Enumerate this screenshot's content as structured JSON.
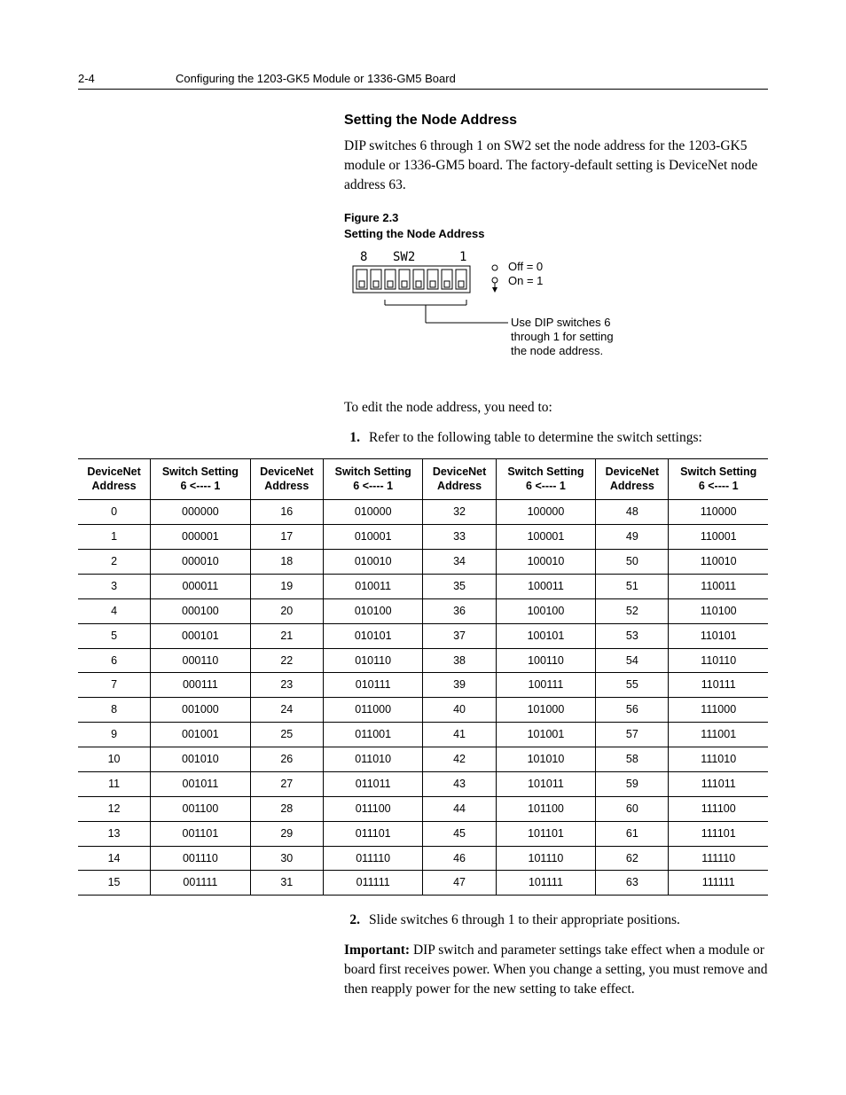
{
  "pageNumber": "2-4",
  "runningHeader": "Configuring the 1203-GK5 Module or 1336-GM5 Board",
  "sectionTitle": "Setting the Node Address",
  "intro": "DIP switches 6 through 1 on SW2 set the node address for the 1203-GK5 module or 1336-GM5 board. The factory-default setting is DeviceNet node address 63.",
  "figureNumber": "Figure 2.3",
  "figureTitle": "Setting the Node Address",
  "fig": {
    "swLeft": "8",
    "swLabel": "SW2",
    "swRight": "1",
    "off": "Off = 0",
    "on": "On = 1",
    "callout1": "Use DIP switches 6",
    "callout2": "through 1 for setting",
    "callout3": "the node address."
  },
  "leadIn": "To edit the node address, you need to:",
  "step1": "Refer to the following table to determine the switch settings:",
  "step2": "Slide switches 6 through 1 to their appropriate positions.",
  "importantLabel": "Important:",
  "importantText": " DIP switch and parameter settings take effect when a module or board first receives power. When you change a setting, you must remove and then reapply power for the new setting to take effect.",
  "table": {
    "hAddr": "DeviceNet Address",
    "hSwitch": "Switch Setting 6 <---- 1",
    "rows": [
      {
        "a0": "0",
        "s0": "000000",
        "a1": "16",
        "s1": "010000",
        "a2": "32",
        "s2": "100000",
        "a3": "48",
        "s3": "110000"
      },
      {
        "a0": "1",
        "s0": "000001",
        "a1": "17",
        "s1": "010001",
        "a2": "33",
        "s2": "100001",
        "a3": "49",
        "s3": "110001"
      },
      {
        "a0": "2",
        "s0": "000010",
        "a1": "18",
        "s1": "010010",
        "a2": "34",
        "s2": "100010",
        "a3": "50",
        "s3": "110010"
      },
      {
        "a0": "3",
        "s0": "000011",
        "a1": "19",
        "s1": "010011",
        "a2": "35",
        "s2": "100011",
        "a3": "51",
        "s3": "110011"
      },
      {
        "a0": "4",
        "s0": "000100",
        "a1": "20",
        "s1": "010100",
        "a2": "36",
        "s2": "100100",
        "a3": "52",
        "s3": "110100"
      },
      {
        "a0": "5",
        "s0": "000101",
        "a1": "21",
        "s1": "010101",
        "a2": "37",
        "s2": "100101",
        "a3": "53",
        "s3": "110101"
      },
      {
        "a0": "6",
        "s0": "000110",
        "a1": "22",
        "s1": "010110",
        "a2": "38",
        "s2": "100110",
        "a3": "54",
        "s3": "110110"
      },
      {
        "a0": "7",
        "s0": "000111",
        "a1": "23",
        "s1": "010111",
        "a2": "39",
        "s2": "100111",
        "a3": "55",
        "s3": "110111"
      },
      {
        "a0": "8",
        "s0": "001000",
        "a1": "24",
        "s1": "011000",
        "a2": "40",
        "s2": "101000",
        "a3": "56",
        "s3": "111000"
      },
      {
        "a0": "9",
        "s0": "001001",
        "a1": "25",
        "s1": "011001",
        "a2": "41",
        "s2": "101001",
        "a3": "57",
        "s3": "111001"
      },
      {
        "a0": "10",
        "s0": "001010",
        "a1": "26",
        "s1": "011010",
        "a2": "42",
        "s2": "101010",
        "a3": "58",
        "s3": "111010"
      },
      {
        "a0": "11",
        "s0": "001011",
        "a1": "27",
        "s1": "011011",
        "a2": "43",
        "s2": "101011",
        "a3": "59",
        "s3": "111011"
      },
      {
        "a0": "12",
        "s0": "001100",
        "a1": "28",
        "s1": "011100",
        "a2": "44",
        "s2": "101100",
        "a3": "60",
        "s3": "111100"
      },
      {
        "a0": "13",
        "s0": "001101",
        "a1": "29",
        "s1": "011101",
        "a2": "45",
        "s2": "101101",
        "a3": "61",
        "s3": "111101"
      },
      {
        "a0": "14",
        "s0": "001110",
        "a1": "30",
        "s1": "011110",
        "a2": "46",
        "s2": "101110",
        "a3": "62",
        "s3": "111110"
      },
      {
        "a0": "15",
        "s0": "001111",
        "a1": "31",
        "s1": "011111",
        "a2": "47",
        "s2": "101111",
        "a3": "63",
        "s3": "111111"
      }
    ]
  }
}
